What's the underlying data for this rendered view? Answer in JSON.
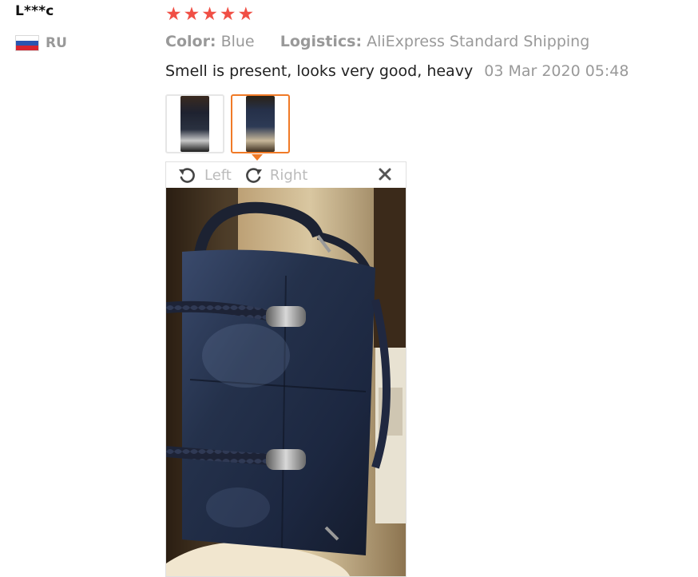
{
  "review": {
    "user_name": "L***c",
    "country_code": "RU",
    "flag_colors": [
      "#ffffff",
      "#2a55b0",
      "#d8242e"
    ],
    "rating": 5,
    "stars": [
      "★",
      "★",
      "★",
      "★",
      "★"
    ],
    "star_color": "#f04f45",
    "color_label": "Color:",
    "color_value": "Blue",
    "logistics_label": "Logistics:",
    "logistics_value": "AliExpress Standard Shipping",
    "text": "Smell is present, looks very good, heavy",
    "date": "03 Mar 2020 05:48"
  },
  "thumbnails": [
    {
      "name": "review-photo-1",
      "selected": false
    },
    {
      "name": "review-photo-2",
      "selected": true
    }
  ],
  "viewer": {
    "rotate_left_label": "Left",
    "rotate_right_label": "Right",
    "rotate_left_icon": "rotate-left-icon",
    "rotate_right_icon": "rotate-right-icon",
    "close_icon": "close-icon",
    "accent_color": "#f07a27"
  }
}
